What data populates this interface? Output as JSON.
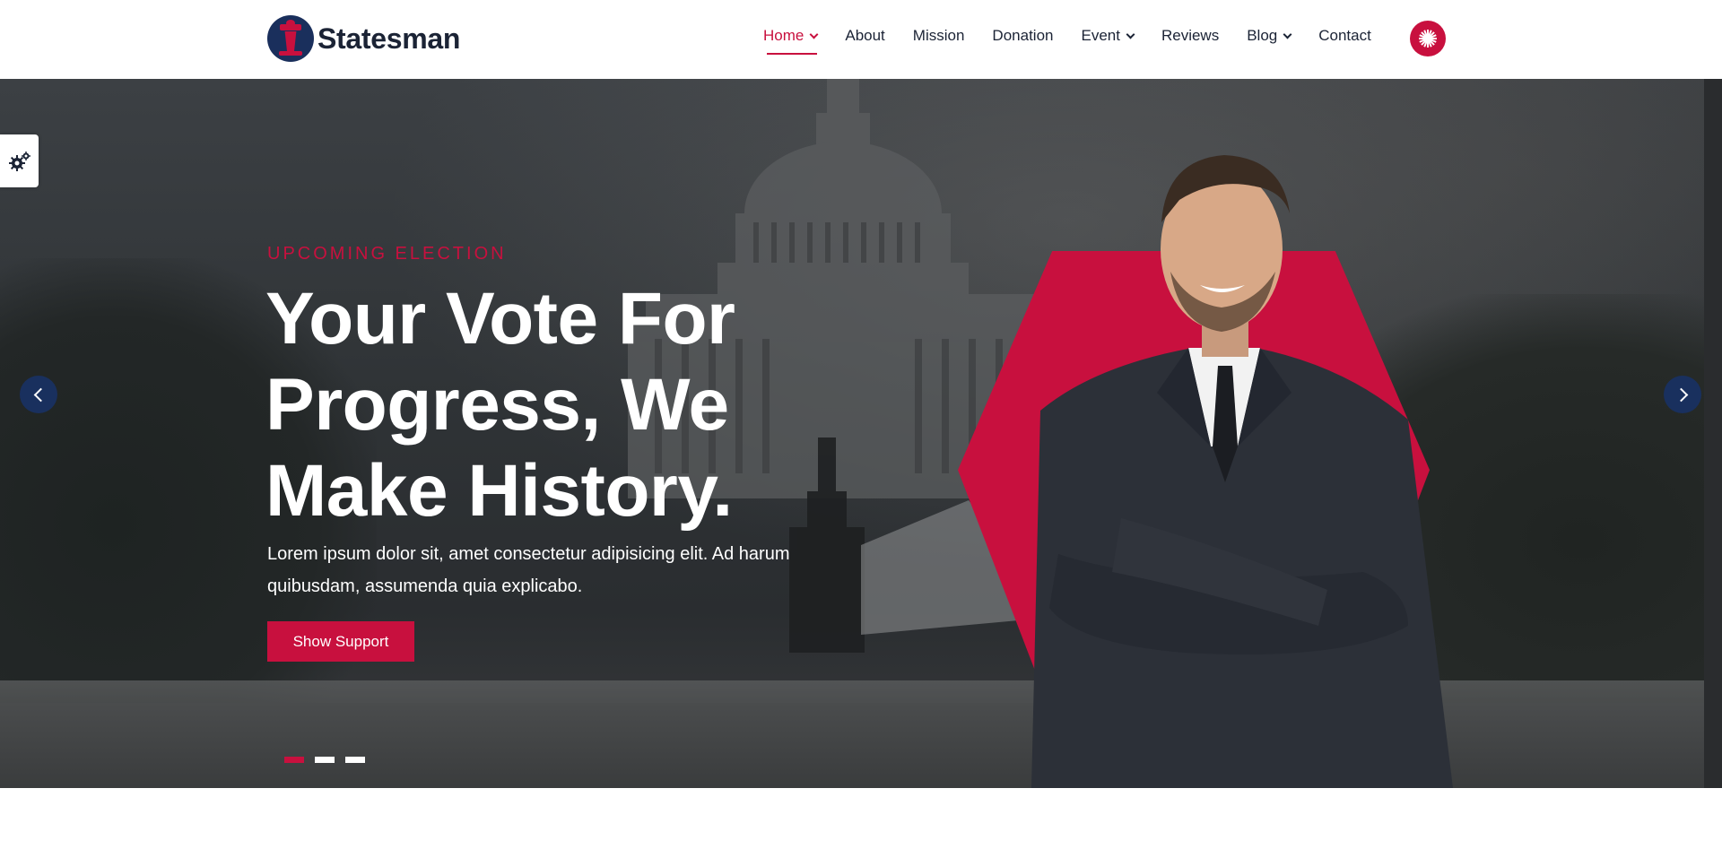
{
  "brand": {
    "name": "Statesman"
  },
  "nav": {
    "items": [
      {
        "label": "Home",
        "active": true,
        "dropdown": true
      },
      {
        "label": "About",
        "active": false,
        "dropdown": false
      },
      {
        "label": "Mission",
        "active": false,
        "dropdown": false
      },
      {
        "label": "Donation",
        "active": false,
        "dropdown": false
      },
      {
        "label": "Event",
        "active": false,
        "dropdown": true
      },
      {
        "label": "Reviews",
        "active": false,
        "dropdown": false
      },
      {
        "label": "Blog",
        "active": false,
        "dropdown": true
      },
      {
        "label": "Contact",
        "active": false,
        "dropdown": false
      }
    ],
    "cta_icon": "sparkle-icon"
  },
  "hero": {
    "eyebrow": "UPCOMING ELECTION",
    "headline_lines": [
      "Your Vote For",
      "Progress, We",
      "Make History."
    ],
    "description": "Lorem ipsum dolor sit, amet consectetur adipisicing elit. Ad harum quibusdam, assumenda quia explicabo.",
    "cta_label": "Show Support",
    "slides": {
      "count": 3,
      "active_index": 0
    }
  },
  "colors": {
    "accent": "#c8103e",
    "navy": "#19305e",
    "text_dark": "#1b2335"
  },
  "icons": {
    "settings": "gear-icon",
    "prev": "chevron-left-icon",
    "next": "chevron-right-icon"
  }
}
